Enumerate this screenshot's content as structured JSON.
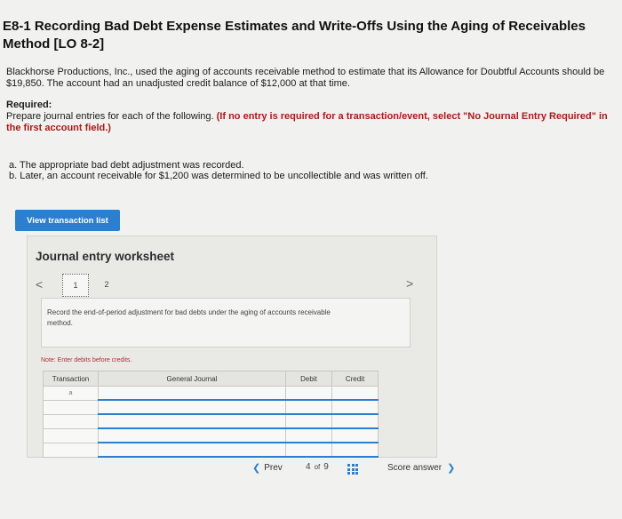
{
  "header": {
    "title": "E8-1 Recording Bad Debt Expense Estimates and Write-Offs Using the Aging of Receivables Method [LO 8-2]"
  },
  "intro": "Blackhorse Productions, Inc., used the aging of accounts receivable method to estimate that its Allowance for Doubtful Accounts should be $19,850. The account had an unadjusted credit balance of $12,000 at that time.",
  "required": {
    "heading": "Required:",
    "text": "Prepare journal entries for each of the following. ",
    "bold": "(If no entry is required for a transaction/event, select \"No Journal Entry Required\" in the first account field.)"
  },
  "tasks": [
    "a. The appropriate bad debt adjustment was recorded.",
    "b. Later, an account receivable for $1,200 was determined to be uncollectible and was written off."
  ],
  "view_button": {
    "label": "View transaction list"
  },
  "worksheet": {
    "title": "Journal entry worksheet",
    "pages": [
      "1",
      "2"
    ],
    "prev_icon": "<",
    "next_icon": ">",
    "instruction": "Record the end-of-period adjustment for bad debts under the aging of accounts receivable method.",
    "note": "Note: Enter debits before credits.",
    "columns": [
      "Transaction",
      "General Journal",
      "Debit",
      "Credit"
    ],
    "first_row_transaction": "a"
  },
  "bottom_nav": {
    "prev_label": "Prev",
    "current": "4",
    "of": "of",
    "total": "9",
    "score_label": "Score answer"
  },
  "colors": {
    "accent": "#2a7fd0",
    "note": "#b03030"
  }
}
